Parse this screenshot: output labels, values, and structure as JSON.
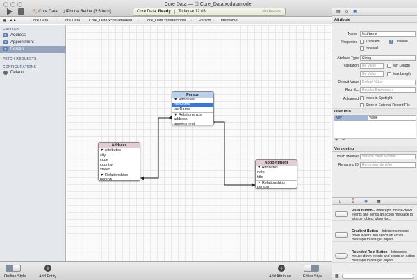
{
  "window": {
    "title": "Core Data — ☐ Core_Data.xcdatamodel"
  },
  "toolbar": {
    "scheme_target": "Core Data",
    "scheme_device": "iPhone Retina (3.5-inch)",
    "status_app": "Core Data:",
    "status_state": "Ready",
    "status_time": "Today at 12:03",
    "status_issues": "No Issues"
  },
  "jumpbar": {
    "crumbs": [
      "Core Data",
      "Core Data",
      "Core_Data.xcdatamodeld",
      "Core_Data.xcdatamodel",
      "Person",
      "firstName"
    ]
  },
  "navigator": {
    "entities_header": "ENTITIES",
    "entities": [
      {
        "badge": "E",
        "label": "Address"
      },
      {
        "badge": "E",
        "label": "Appointment"
      },
      {
        "badge": "E",
        "label": "Person"
      }
    ],
    "fetch_header": "FETCH REQUESTS",
    "config_header": "CONFIGURATIONS",
    "configs": [
      {
        "label": "Default"
      }
    ]
  },
  "diagram": {
    "person": {
      "name": "Person",
      "attributes_label": "▼ Attributes",
      "attributes": [
        "firstName",
        "lastName"
      ],
      "relationships_label": "▼ Relationships",
      "relationships": [
        "address",
        "appointment"
      ]
    },
    "address": {
      "name": "Address",
      "attributes_label": "▼ Attributes",
      "attributes": [
        "city",
        "code",
        "country",
        "street"
      ],
      "relationships_label": "▼ Relationships",
      "relationships": [
        "person"
      ]
    },
    "appointment": {
      "name": "Appointment",
      "attributes_label": "▼ Attributes",
      "attributes": [
        "date",
        "title"
      ],
      "relationships_label": "▼ Relationships",
      "relationships": [
        "person"
      ]
    }
  },
  "bottombar": {
    "outline_style": "Outline Style",
    "add_entity": "Add Entity",
    "add_attribute": "Add Attribute",
    "editor_style": "Editor Style"
  },
  "inspector": {
    "attribute_header": "Attribute",
    "name_label": "Name",
    "name_value": "firstName",
    "properties_label": "Properties",
    "transient": "Transient",
    "optional": "Optional",
    "indexed": "Indexed",
    "type_label": "Attribute Type",
    "type_value": "String",
    "validation_label": "Validation",
    "no_value": "No Value",
    "min_length": "Min Length",
    "max_length": "Max Length",
    "default_label": "Default Value",
    "default_placeholder": "Default Value",
    "regex_label": "Reg. Ex.",
    "regex_placeholder": "Regular Expression",
    "advanced_label": "Advanced",
    "spotlight": "Index in Spotlight",
    "external": "Store in External Record File",
    "userinfo_header": "User Info",
    "key_col": "Key",
    "value_col": "Value",
    "versioning_header": "Versioning",
    "hash_label": "Hash Modifier",
    "hash_placeholder": "Version Hash Modifier",
    "renaming_label": "Renaming ID",
    "renaming_placeholder": "Renaming Identifier"
  },
  "library": {
    "items": [
      {
        "title": "Push Button",
        "desc": " – Intercepts mouse-down events and sends an action message to a target object when it's..."
      },
      {
        "title": "Gradient Button",
        "desc": " – Intercepts mouse-down events and sends an action message to a target object..."
      },
      {
        "title": "Rounded Rect Button",
        "desc": " – Intercepts mouse-down events and sends an action message to a target object..."
      }
    ]
  },
  "colors": {
    "selection": "#3d77d1",
    "person_header": "#b9d1ef",
    "other_header": "#e2cdd3"
  }
}
